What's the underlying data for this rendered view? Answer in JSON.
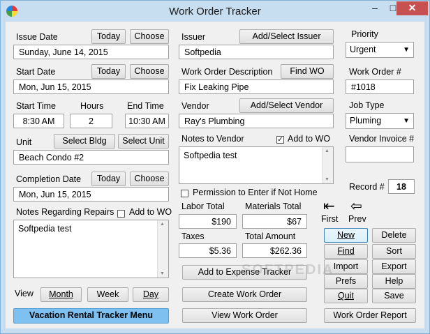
{
  "window": {
    "title": "Work Order Tracker",
    "min_glyph": "–",
    "max_glyph": "□",
    "close_glyph": "✕"
  },
  "issue_date": {
    "label": "Issue Date",
    "value": "Sunday, June 14, 2015"
  },
  "start_date": {
    "label": "Start Date",
    "value": "Mon, Jun 15, 2015"
  },
  "start_time": {
    "label": "Start Time",
    "value": "8:30 AM"
  },
  "hours": {
    "label": "Hours",
    "value": "2"
  },
  "end_time": {
    "label": "End Time",
    "value": "10:30 AM"
  },
  "unit": {
    "label": "Unit",
    "value": "Beach Condo #2"
  },
  "completion_date": {
    "label": "Completion Date",
    "value": "Mon, Jun 15, 2015"
  },
  "notes_repairs": {
    "label": "Notes Regarding Repairs",
    "add_to_wo": "Add to WO",
    "value": "Softpedia test"
  },
  "view": {
    "label": "View",
    "month": "Month",
    "week": "Week",
    "day": "Day"
  },
  "buttons": {
    "today": "Today",
    "choose": "Choose",
    "select_bldg": "Select Bldg",
    "select_unit": "Select Unit",
    "add_select_issuer": "Add/Select Issuer",
    "find_wo": "Find WO",
    "add_select_vendor": "Add/Select Vendor",
    "add_to_expense": "Add to Expense Tracker",
    "create_wo": "Create Work Order",
    "view_wo": "View Work Order",
    "vacation_menu": "Vacation Rental Tracker Menu",
    "new": "New",
    "delete": "Delete",
    "find": "Find",
    "sort": "Sort",
    "import": "Import",
    "export": "Export",
    "prefs": "Prefs",
    "help": "Help",
    "quit": "Quit",
    "save": "Save",
    "wo_report": "Work Order Report"
  },
  "issuer": {
    "label": "Issuer",
    "value": "Softpedia"
  },
  "wo_description": {
    "label": "Work Order Description",
    "value": "Fix Leaking Pipe"
  },
  "vendor": {
    "label": "Vendor",
    "value": "Ray's Plumbing"
  },
  "notes_vendor": {
    "label": "Notes to Vendor",
    "add_to_wo": "Add to WO",
    "checked_glyph": "✓",
    "value": "Softpedia test"
  },
  "permission": {
    "label": "Permission to Enter if Not Home"
  },
  "labor_total": {
    "label": "Labor Total",
    "value": "$190"
  },
  "materials_total": {
    "label": "Materials Total",
    "value": "$67"
  },
  "taxes": {
    "label": "Taxes",
    "value": "$5.36"
  },
  "total_amount": {
    "label": "Total Amount",
    "value": "$262.36"
  },
  "priority": {
    "label": "Priority",
    "value": "Urgent"
  },
  "work_order_no": {
    "label": "Work Order #",
    "value": "#1018"
  },
  "job_type": {
    "label": "Job Type",
    "value": "Pluming"
  },
  "vendor_invoice": {
    "label": "Vendor Invoice #",
    "value": ""
  },
  "record": {
    "label": "Record #",
    "value": "18"
  },
  "nav": {
    "first": "First",
    "prev": "Prev"
  },
  "watermark": "SOFTPEDIA"
}
